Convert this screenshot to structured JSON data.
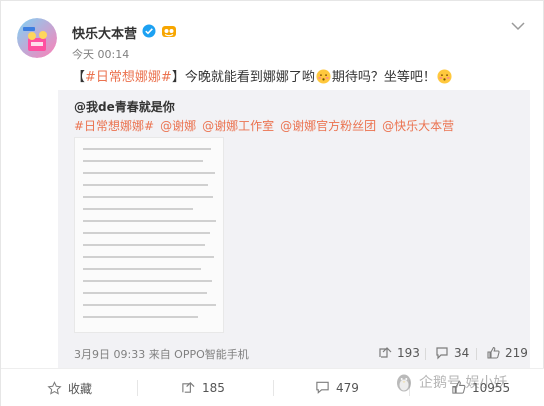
{
  "post": {
    "author": "快乐大本营",
    "time": "今天 00:14",
    "text_prefix": "【",
    "topic": "#日常想娜娜#",
    "text_middle": "】今晚就能看到娜娜了哟",
    "text_end": "期待吗？坐等吧！"
  },
  "repost": {
    "author": "@我de青春就是你",
    "tags": [
      "#日常想娜娜#",
      "@谢娜",
      "@谢娜工作室",
      "@谢娜官方粉丝团",
      "@快乐大本营"
    ],
    "meta": "3月9日 09:33 来自 OPPO智能手机",
    "forwards": "193",
    "comments": "34",
    "likes": "219"
  },
  "footer": {
    "favorite_label": "收藏",
    "forwards": "185",
    "comments": "479",
    "likes": "10955"
  },
  "watermark": "企鹅号 娱小妖",
  "colors": {
    "accent": "#eb7350",
    "repost_bg": "#f2f2f5",
    "muted": "#808080"
  }
}
